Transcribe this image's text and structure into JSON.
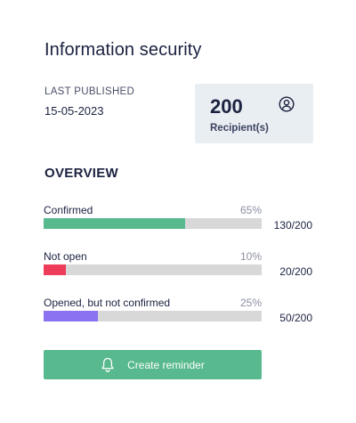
{
  "header": {
    "title": "Information security"
  },
  "published": {
    "label": "LAST PUBLISHED",
    "date": "15-05-2023"
  },
  "recipients": {
    "count": "200",
    "label": "Recipient(s)",
    "icon": "user-circle-icon"
  },
  "overview": {
    "heading": "OVERVIEW",
    "stats": [
      {
        "label": "Confirmed",
        "percent": "65%",
        "count": "130/200",
        "fraction": 0.65,
        "color": "#57b98d"
      },
      {
        "label": "Not open",
        "percent": "10%",
        "count": "20/200",
        "fraction": 0.1,
        "color": "#ee3d5a"
      },
      {
        "label": "Opened, but not confirmed",
        "percent": "25%",
        "count": "50/200",
        "fraction": 0.25,
        "color": "#8b72f0"
      }
    ],
    "track_color": "#d8d8d8"
  },
  "reminder_button": {
    "label": "Create reminder",
    "icon": "bell-icon",
    "color": "#57b98d"
  }
}
